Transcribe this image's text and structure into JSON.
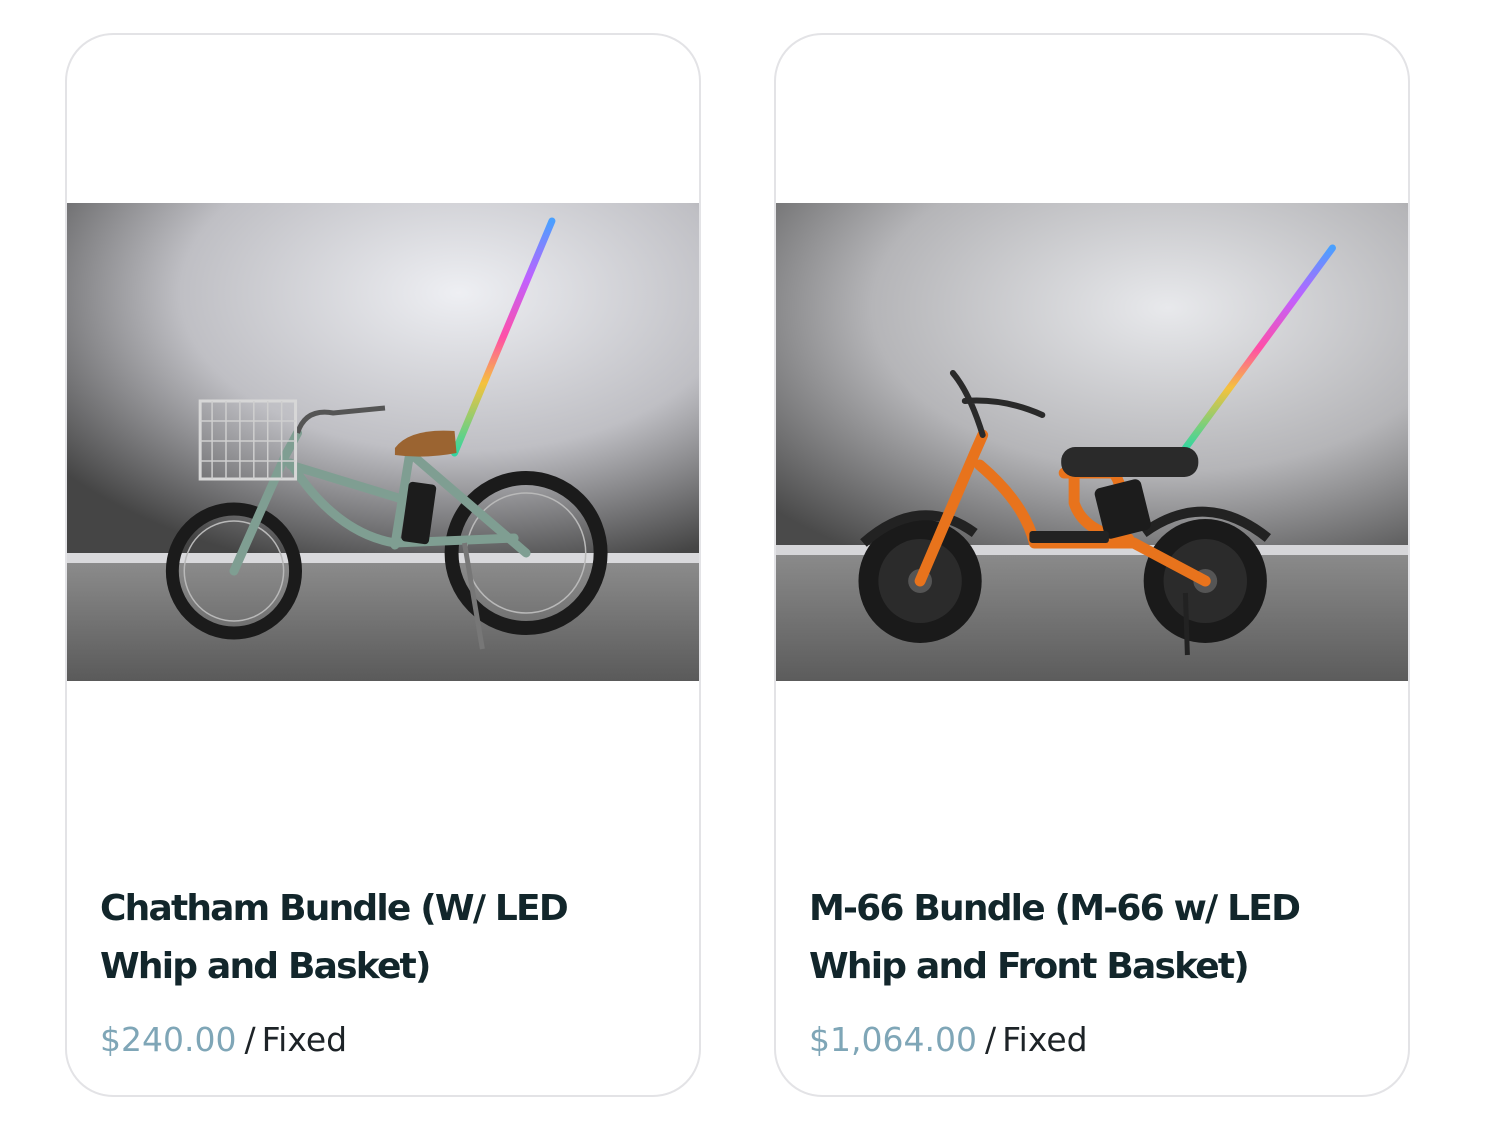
{
  "products": [
    {
      "image_icon": "bicycle-photo-icon",
      "title": "Chatham Bundle (W/ LED Whip and Basket)",
      "price": "$240.00",
      "separator": "/",
      "price_type": "Fixed",
      "frame_color": "#7f9e92"
    },
    {
      "image_icon": "ebike-photo-icon",
      "title": "M-66 Bundle (M-66 w/ LED Whip and Front Basket)",
      "price": "$1,064.00",
      "separator": "/",
      "price_type": "Fixed",
      "frame_color": "#e8731c"
    }
  ],
  "colors": {
    "title": "#12262b",
    "price": "#7fa6b7",
    "card_border": "#e3e3e6"
  }
}
